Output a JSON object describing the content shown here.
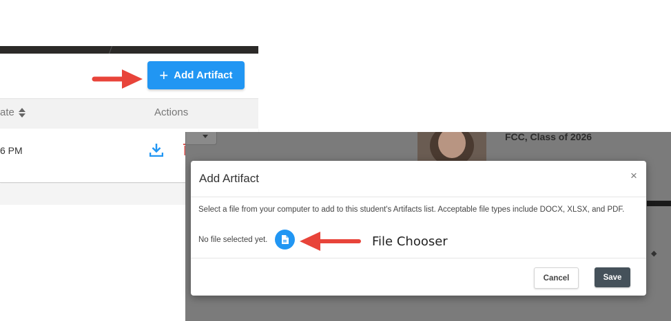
{
  "left_panel": {
    "add_button": {
      "label": "Add Artifact",
      "icon": "plus-icon",
      "color": "#2196f3"
    },
    "table": {
      "headers": {
        "date_partial": "ate",
        "actions": "Actions"
      },
      "rows": [
        {
          "time_partial": "6 PM",
          "actions": [
            "download-icon",
            "delete-icon"
          ]
        }
      ]
    }
  },
  "right_panel": {
    "student_class": "FCC, Class of 2026"
  },
  "modal": {
    "title": "Add Artifact",
    "close_icon": "×",
    "description": "Select a file from your computer to add to this student's Artifacts list. Acceptable file types include DOCX, XLSX, and PDF.",
    "no_file_text": "No file selected yet.",
    "file_chooser_icon": "file-icon",
    "cancel_label": "Cancel",
    "save_label": "Save",
    "save_color": "#45515a"
  },
  "annotations": {
    "file_chooser_label": "File Chooser",
    "arrow_color": "#e8443a"
  }
}
